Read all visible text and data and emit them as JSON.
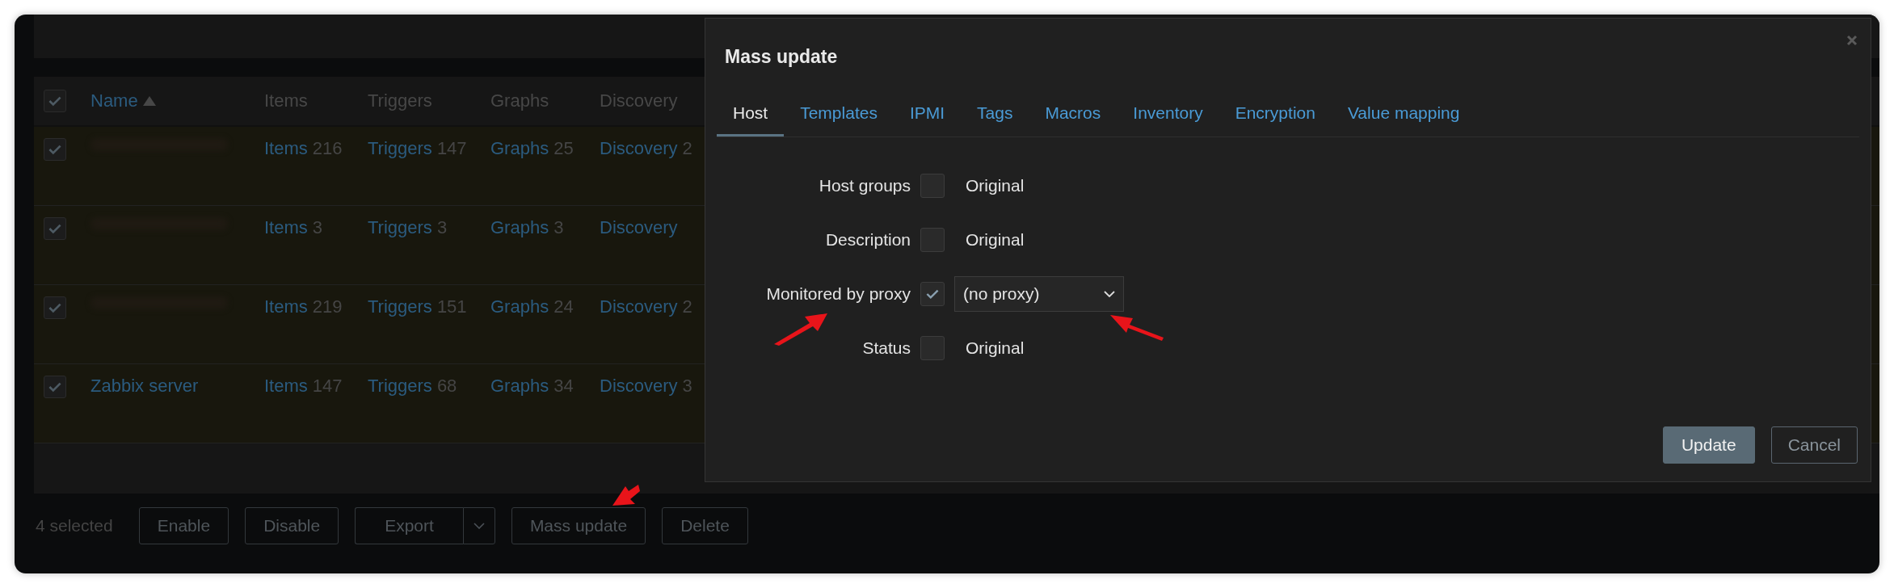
{
  "table": {
    "header_checked": true,
    "columns": [
      {
        "label": "Name",
        "kind": "sort"
      },
      {
        "label": "Items",
        "kind": "plain"
      },
      {
        "label": "Triggers",
        "kind": "plain"
      },
      {
        "label": "Graphs",
        "kind": "plain"
      },
      {
        "label": "Discovery",
        "kind": "plain"
      }
    ],
    "rows": [
      {
        "checked": true,
        "cells": [
          {
            "kind": "redacted"
          },
          {
            "kind": "count",
            "link": "Items",
            "count": "216"
          },
          {
            "kind": "count",
            "link": "Triggers",
            "count": "147"
          },
          {
            "kind": "count",
            "link": "Graphs",
            "count": "25"
          },
          {
            "kind": "count",
            "link": "Discovery",
            "count": "2"
          }
        ]
      },
      {
        "checked": true,
        "cells": [
          {
            "kind": "redacted"
          },
          {
            "kind": "count",
            "link": "Items",
            "count": "3"
          },
          {
            "kind": "count",
            "link": "Triggers",
            "count": "3"
          },
          {
            "kind": "count",
            "link": "Graphs",
            "count": "3"
          },
          {
            "kind": "count",
            "link": "Discovery"
          }
        ]
      },
      {
        "checked": true,
        "cells": [
          {
            "kind": "redacted"
          },
          {
            "kind": "count",
            "link": "Items",
            "count": "219"
          },
          {
            "kind": "count",
            "link": "Triggers",
            "count": "151"
          },
          {
            "kind": "count",
            "link": "Graphs",
            "count": "24"
          },
          {
            "kind": "count",
            "link": "Discovery",
            "count": "2"
          }
        ]
      },
      {
        "checked": true,
        "cells": [
          {
            "kind": "name",
            "text": "Zabbix server"
          },
          {
            "kind": "count",
            "link": "Items",
            "count": "147"
          },
          {
            "kind": "count",
            "link": "Triggers",
            "count": "68"
          },
          {
            "kind": "count",
            "link": "Graphs",
            "count": "34"
          },
          {
            "kind": "count",
            "link": "Discovery",
            "count": "3"
          }
        ]
      }
    ]
  },
  "footer": {
    "selected": "4 selected",
    "buttons": [
      {
        "label": "Enable",
        "kind": "plain"
      },
      {
        "label": "Disable",
        "kind": "plain"
      },
      {
        "label": "Export",
        "kind": "split"
      },
      {
        "label": "Mass update",
        "kind": "plain"
      },
      {
        "label": "Delete",
        "kind": "plain"
      }
    ]
  },
  "dialog": {
    "title": "Mass update",
    "tabs": [
      {
        "label": "Host",
        "selected": true
      },
      {
        "label": "Templates",
        "selected": false
      },
      {
        "label": "IPMI",
        "selected": false
      },
      {
        "label": "Tags",
        "selected": false
      },
      {
        "label": "Macros",
        "selected": false
      },
      {
        "label": "Inventory",
        "selected": false
      },
      {
        "label": "Encryption",
        "selected": false
      },
      {
        "label": "Value mapping",
        "selected": false
      }
    ],
    "fields": [
      {
        "label": "Host groups",
        "checked": false,
        "kind": "text",
        "value": "Original"
      },
      {
        "label": "Description",
        "checked": false,
        "kind": "text",
        "value": "Original"
      },
      {
        "label": "Monitored by proxy",
        "checked": true,
        "kind": "select",
        "value": "(no proxy)"
      },
      {
        "label": "Status",
        "checked": false,
        "kind": "text",
        "value": "Original"
      }
    ],
    "buttons": [
      {
        "label": "Update",
        "kind": "primary"
      },
      {
        "label": "Cancel",
        "kind": "secondary"
      }
    ]
  }
}
